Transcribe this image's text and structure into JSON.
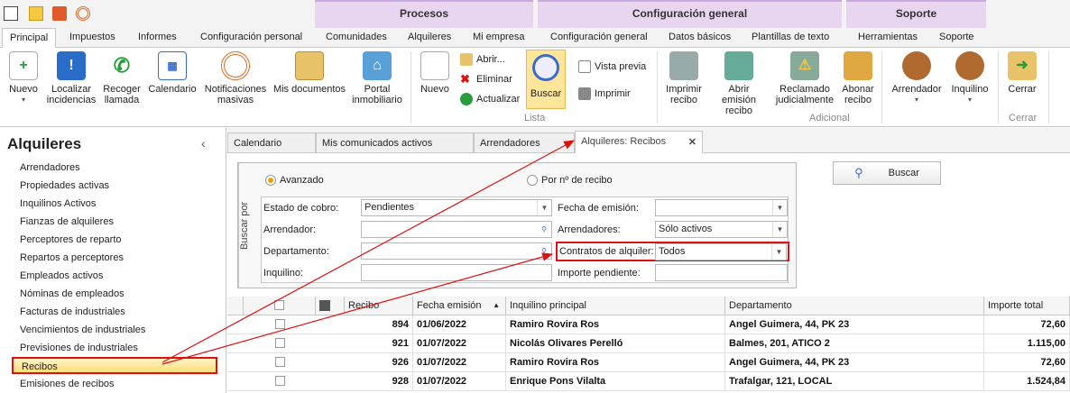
{
  "ribbon_groups": {
    "procesos": "Procesos",
    "config": "Configuración general",
    "soporte": "Soporte"
  },
  "tabs": [
    "Principal",
    "Impuestos",
    "Informes",
    "Configuración personal",
    "Comunidades",
    "Alquileres",
    "Mi empresa",
    "Configuración general",
    "Datos básicos",
    "Plantillas de texto",
    "Herramientas",
    "Soporte"
  ],
  "buttons": {
    "nuevo": "Nuevo",
    "localizar": "Localizar incidencias",
    "recoger": "Recoger llamada",
    "calendario": "Calendario",
    "notif": "Notificaciones masivas",
    "misdocs": "Mis documentos",
    "portal": "Portal inmobiliario",
    "nuevo2": "Nuevo",
    "abrir": "Abrir...",
    "eliminar": "Eliminar",
    "actualizar": "Actualizar",
    "buscar": "Buscar",
    "vista": "Vista previa",
    "imprimir": "Imprimir",
    "imprimir_recibo": "Imprimir recibo",
    "abrir_emision": "Abrir emisión recibo",
    "reclamado": "Reclamado judicialmente",
    "abonar": "Abonar recibo",
    "arrendador": "Arrendador",
    "inquilino": "Inquilino",
    "cerrar": "Cerrar"
  },
  "group_labels": {
    "lista": "Lista",
    "adicional": "Adicional",
    "cerrar": "Cerrar"
  },
  "sidebar": {
    "title": "Alquileres",
    "items": [
      "Arrendadores",
      "Propiedades activas",
      "Inquilinos Activos",
      "Fianzas de alquileres",
      "Perceptores de reparto",
      "Repartos a perceptores",
      "Empleados activos",
      "Nóminas de empleados",
      "Facturas de industriales",
      "Vencimientos de industriales",
      "Previsiones de industriales",
      "Recibos",
      "Emisiones de recibos"
    ]
  },
  "doc_tabs": [
    "Calendario",
    "Mis comunicados activos",
    "Arrendadores",
    "Alquileres: Recibos"
  ],
  "filter": {
    "side_label": "Buscar por",
    "radio_avanzado": "Avanzado",
    "radio_recibo": "Por nº de recibo",
    "estado_label": "Estado de cobro:",
    "estado_value": "Pendientes",
    "fecha_label": "Fecha de emisión:",
    "fecha_value": "",
    "arrendador_label": "Arrendador:",
    "arrendador_value": "",
    "arrendadores_label": "Arrendadores:",
    "arrendadores_value": "Sólo activos",
    "departamento_label": "Departamento:",
    "departamento_value": "",
    "contratos_label": "Contratos de alquiler:",
    "contratos_value": "Todos",
    "inquilino_label": "Inquilino:",
    "inquilino_value": "",
    "importe_label": "Importe pendiente:",
    "importe_value": "",
    "buscar_button": "Buscar"
  },
  "table": {
    "headers": [
      "Recibo",
      "Fecha emisión",
      "Inquilino principal",
      "Departamento",
      "Importe total"
    ],
    "rows": [
      {
        "recibo": "894",
        "fecha": "01/06/2022",
        "inquilino": "Ramiro Rovira Ros",
        "departamento": "Angel Guimera, 44, PK 23",
        "importe": "72,60"
      },
      {
        "recibo": "921",
        "fecha": "01/07/2022",
        "inquilino": "Nicolás Olivares Perelló",
        "departamento": "Balmes, 201, ATICO 2",
        "importe": "1.115,00"
      },
      {
        "recibo": "926",
        "fecha": "01/07/2022",
        "inquilino": "Ramiro Rovira Ros",
        "departamento": "Angel Guimera, 44, PK 23",
        "importe": "72,60"
      },
      {
        "recibo": "928",
        "fecha": "01/07/2022",
        "inquilino": "Enrique Pons Vilalta",
        "departamento": "Trafalgar, 121, LOCAL",
        "importe": "1.524,84"
      }
    ]
  }
}
